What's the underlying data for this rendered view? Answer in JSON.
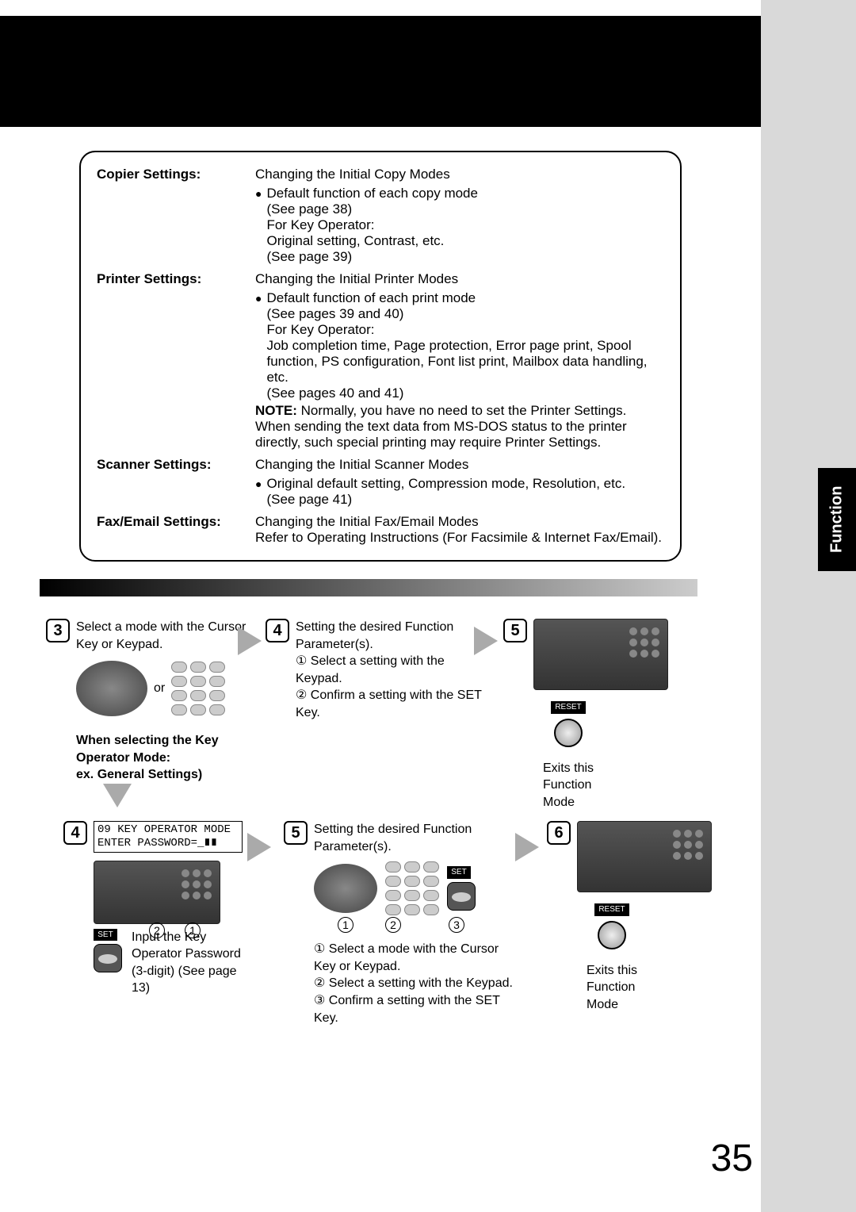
{
  "page_number": "35",
  "side_tab": "Function",
  "settings": {
    "copier": {
      "label": "Copier Settings:",
      "title": "Changing the Initial Copy Modes",
      "bullet": "Default function of each copy mode\n(See page 38)\nFor Key Operator:\nOriginal setting, Contrast, etc.\n(See page 39)"
    },
    "printer": {
      "label": "Printer Settings:",
      "title": "Changing the Initial Printer Modes",
      "bullet": "Default function of each print mode\n(See pages 39 and 40)\nFor Key Operator:\nJob completion time, Page protection, Error page print, Spool function, PS configuration, Font list print, Mailbox data handling, etc.\n(See pages 40 and 41)",
      "note_label": "NOTE:",
      "note_text": "Normally, you have no need to set the Printer Settings. When sending the text data from MS-DOS status to the printer directly, such special printing may require Printer Settings."
    },
    "scanner": {
      "label": "Scanner Settings:",
      "title": "Changing the Initial Scanner Modes",
      "bullet": "Original default setting, Compression mode, Resolution, etc.\n(See page 41)"
    },
    "fax": {
      "label": "Fax/Email Settings:",
      "title": "Changing the Initial Fax/Email Modes",
      "body": "Refer to Operating Instructions (For Facsimile & Internet Fax/Email)."
    }
  },
  "steps": {
    "s3": {
      "num": "3",
      "text": "Select a mode with the Cursor Key or Keypad.",
      "or": "or",
      "sub_bold1": "When selecting the Key Operator Mode:",
      "sub_bold2": "ex. General Settings)"
    },
    "s4a": {
      "num": "4",
      "text": "Setting the desired Function Parameter(s).",
      "l1": "Select a setting with the Keypad.",
      "l2": "Confirm a setting with the SET Key."
    },
    "s5top": {
      "num": "5",
      "reset": "RESET",
      "exit": "Exits this Function Mode"
    },
    "s4b": {
      "num": "4",
      "lcd_l1": "09 KEY OPERATOR MODE",
      "lcd_l2": "ENTER PASSWORD=_∎∎",
      "input_text": "Input the Key Operator Password (3-digit) (See page 13)",
      "set": "SET"
    },
    "s5b": {
      "num": "5",
      "text": "Setting the desired Function Parameter(s).",
      "l1": "Select a mode with the Cursor Key or Keypad.",
      "l2": "Select a setting with the Keypad.",
      "l3": "Confirm a setting with the SET Key.",
      "set": "SET"
    },
    "s6": {
      "num": "6",
      "reset": "RESET",
      "exit": "Exits this Function Mode"
    }
  }
}
